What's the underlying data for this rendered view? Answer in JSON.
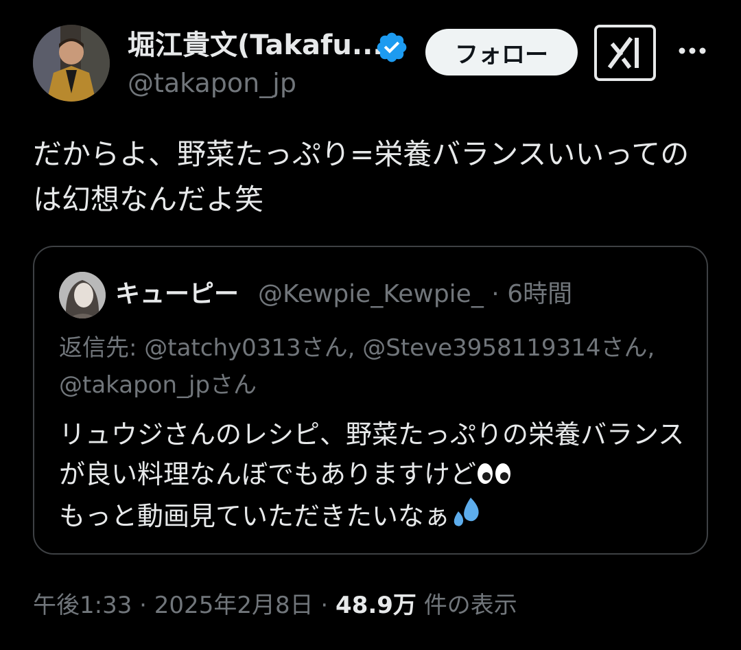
{
  "author": {
    "display_name": "堀江貴文(Takafu...",
    "handle": "@takapon_jp",
    "verified_icon": "verified-badge-icon",
    "accent": "#1d9bf0"
  },
  "actions": {
    "follow_label": "フォロー",
    "grok_icon": "grok-icon",
    "more_icon": "more-horizontal-icon"
  },
  "tweet": {
    "text": "だからよ、野菜たっぷり=栄養バランスいいってのは幻想なんだよ笑"
  },
  "quote": {
    "display_name": "キューピー",
    "handle": "@Kewpie_Kewpie_",
    "separator": "·",
    "time": "6時間",
    "reply_to": "返信先: @tatchy0313さん, @Steve3958119314さん, @takapon_jpさん",
    "text_line1": "リュウジさんのレシピ、野菜たっぷりの栄養バランスが良い料理なんぼでもありますけど",
    "text_line2": "もっと動画見ていただきたいなぁ",
    "emoji1": "eyes-emoji",
    "emoji2": "sweat-droplets-emoji"
  },
  "footer": {
    "time": "午後1:33",
    "sep1": "·",
    "date": "2025年2月8日",
    "sep2": "·",
    "views_count": "48.9万",
    "views_label": "件の表示"
  }
}
